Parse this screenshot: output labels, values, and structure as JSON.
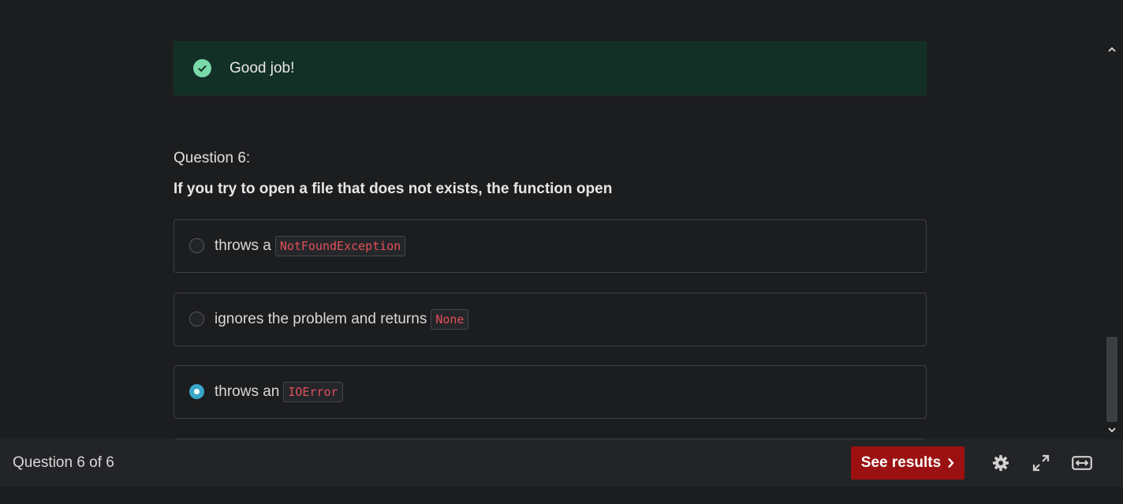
{
  "feedback": {
    "message": "Good job!",
    "icon": "check-circle-icon",
    "color": "#133027"
  },
  "question": {
    "number_label": "Question 6:",
    "text": "If you try to open a file that does not exists, the function open",
    "options": [
      {
        "text": "throws a",
        "code": "NotFoundException",
        "selected": false
      },
      {
        "text": "ignores the problem and returns",
        "code": "None",
        "selected": false
      },
      {
        "text": "throws an",
        "code": "IOError",
        "selected": true
      }
    ]
  },
  "footer": {
    "progress": "Question 6 of 6",
    "results_button": "See results",
    "icons": [
      "gear-icon",
      "expand-icon",
      "width-toggle-icon"
    ]
  },
  "colors": {
    "accent": "#9b1111",
    "selected": "#3aa7c9",
    "code": "#e2505a"
  }
}
